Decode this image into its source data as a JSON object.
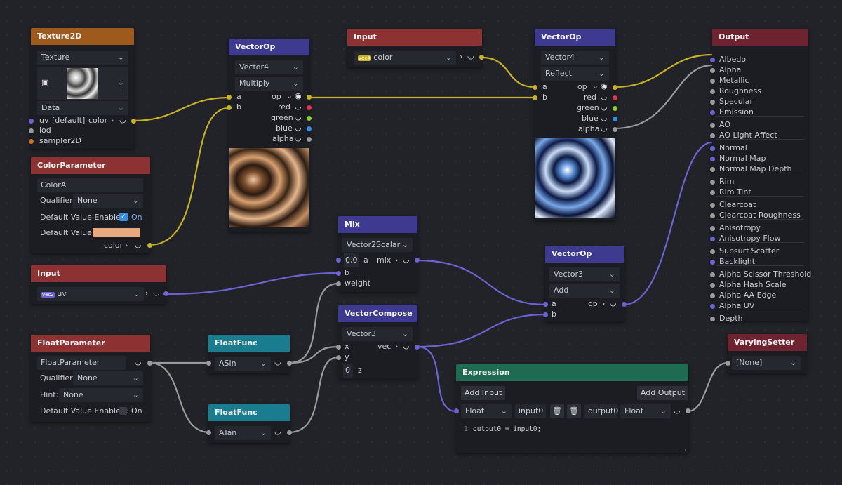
{
  "colors": {
    "wire_yellow": "#c9b224",
    "wire_purple": "#6c63d3",
    "wire_gray": "#9a9a9a",
    "accent_blue": "#3d3a8f",
    "accent_red": "#8c3232"
  },
  "texture2d": {
    "title": "Texture2D",
    "type_select": "Texture",
    "data_select": "Data",
    "image_icon": "image-icon",
    "uv_label": "uv",
    "uv_default": "[default]",
    "out_label": "color",
    "lod_label": "lod",
    "sampler_label": "sampler2D"
  },
  "color_param": {
    "title": "ColorParameter",
    "name": "ColorA",
    "qualifier_label": "Qualifier:",
    "qualifier_value": "None",
    "dve_label": "Default Value Enabled:",
    "dve_value": "On",
    "dv_label": "Default Value:",
    "swatch_color": "#e8a97e",
    "out_label": "color"
  },
  "input_uv": {
    "title": "Input",
    "tag": "vec2",
    "value": "uv"
  },
  "float_param": {
    "title": "FloatParameter",
    "name": "FloatParameter",
    "qualifier_label": "Qualifier:",
    "qualifier_value": "None",
    "hint_label": "Hint:",
    "hint_value": "None",
    "dve_label": "Default Value Enabled:",
    "dve_value": "On"
  },
  "ff_asin": {
    "title": "FloatFunc",
    "func": "ASin"
  },
  "ff_atan": {
    "title": "FloatFunc",
    "func": "ATan"
  },
  "vop1": {
    "title": "VectorOp",
    "type": "Vector4",
    "op": "Multiply",
    "a": "a",
    "op_label": "op",
    "b": "b",
    "red": "red",
    "green": "green",
    "blue": "blue",
    "alpha": "alpha"
  },
  "input_color": {
    "title": "Input",
    "tag": "vec4",
    "value": "color"
  },
  "vop2": {
    "title": "VectorOp",
    "type": "Vector4",
    "op": "Reflect",
    "a": "a",
    "op_label": "op",
    "b": "b",
    "red": "red",
    "green": "green",
    "blue": "blue",
    "alpha": "alpha"
  },
  "mix": {
    "title": "Mix",
    "type": "Vector2Scalar",
    "a_value": "0,0",
    "a": "a",
    "out": "mix",
    "b": "b",
    "weight": "weight"
  },
  "vcompose": {
    "title": "VectorCompose",
    "type": "Vector3",
    "x": "x",
    "out": "vec",
    "y": "y",
    "z_value": "0",
    "z": "z"
  },
  "vop3": {
    "title": "VectorOp",
    "type": "Vector3",
    "op": "Add",
    "a": "a",
    "op_label": "op",
    "b": "b"
  },
  "expression": {
    "title": "Expression",
    "add_input": "Add Input",
    "add_output": "Add Output",
    "in_type": "Float",
    "in_name": "input0",
    "out_name": "output0",
    "out_type": "Float",
    "code_line_no": "1",
    "code": "output0 = input0;"
  },
  "varying": {
    "title": "VaryingSetter",
    "value": "[None]"
  },
  "output": {
    "title": "Output",
    "items": [
      "Albedo",
      "Alpha",
      "Metallic",
      "Roughness",
      "Specular",
      "Emission",
      "AO",
      "AO Light Affect",
      "Normal",
      "Normal Map",
      "Normal Map Depth",
      "Rim",
      "Rim Tint",
      "Clearcoat",
      "Clearcoat Roughness",
      "Anisotropy",
      "Anisotropy Flow",
      "Subsurf Scatter",
      "Backlight",
      "Alpha Scissor Threshold",
      "Alpha Hash Scale",
      "Alpha AA Edge",
      "Alpha UV",
      "Depth"
    ]
  }
}
